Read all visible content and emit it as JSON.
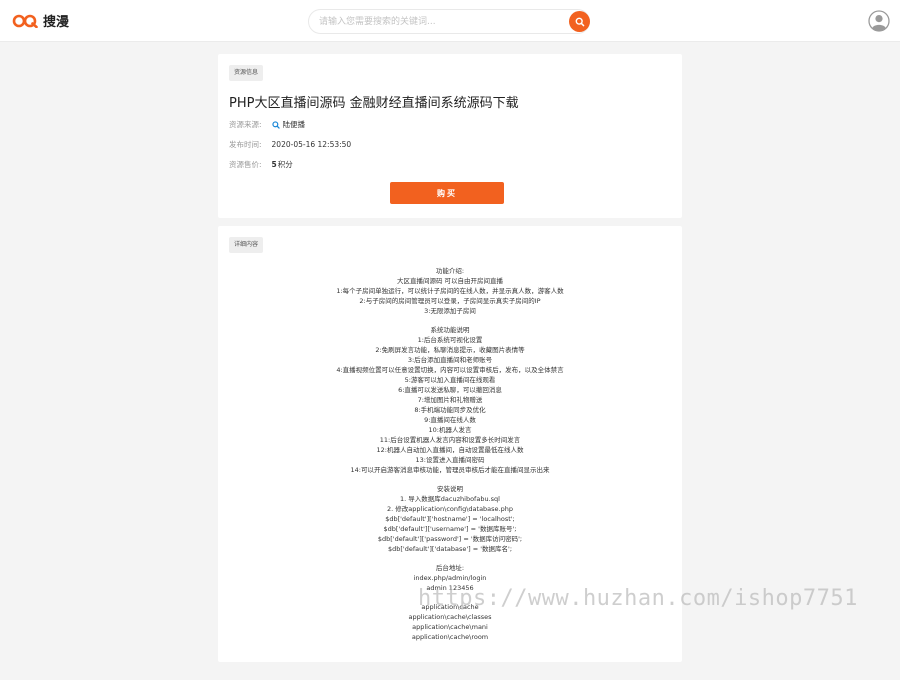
{
  "header": {
    "logo_text": "搜漫",
    "logo_color": "#f2611f",
    "search_placeholder": "请输入您需要搜索的关键词...",
    "search_icon": "search-icon",
    "avatar_icon": "user-avatar-icon"
  },
  "resource": {
    "tag": "资源信息",
    "title": "PHP大区直播间源码 金融财经直播间系统源码下载",
    "source_label": "资源来源:",
    "source_value": "陆便播",
    "date_label": "发布时间:",
    "date_value": "2020-05-16 12:53:50",
    "price_label": "资源售价:",
    "price_value": "5",
    "price_unit": "积分",
    "buy_label": "购买",
    "accent": "#f2611f",
    "link_color": "#1a87d6"
  },
  "detail": {
    "tag": "详细内容",
    "lines": [
      "功能介绍:",
      "大区直播间源码 可以自由开房间直播",
      "1:每个子房间单独运行，可以统计子房间的在线人数，并显示真人数，游客人数",
      "2:与子房间的房间管理员可以登录，子房间显示真实子房间的IP",
      "3:无限添加子房间",
      "",
      "系统功能说明",
      "1:后台系统可视化设置",
      "2:免刷屏发言功能，私聊消息提示，收藏图片表情等",
      "3:后台添加直播间和老师账号",
      "4:直播视频位置可以任意设置切换，内容可以设置审核后，发布，以及全体禁言",
      "5:游客可以加入直播间在线观看",
      "6:直播可以发送私聊，可以撤回消息",
      "7:增加图片和礼物赠送",
      "8:手机端功能同步及优化",
      "9:直播间在线人数",
      "10:机器人发言",
      "11:后台设置机器人发言内容和设置多长时间发言",
      "12:机器人自动加入直播间，自动设置最低在线人数",
      "13:设置进入直播间密码",
      "14:可以开启游客消息审核功能，管理员审核后才能在直播间显示出来",
      "",
      "安装说明",
      "1. 导入数据库dacuzhibofabu.sql",
      "2. 修改application\\config\\database.php",
      "$db['default']['hostname'] = 'localhost';",
      "$db['default']['username'] = '数据库账号';",
      "$db['default']['password'] = '数据库访问密码';",
      "$db['default']['database'] = '数据库名';",
      "",
      "后台地址:",
      "index.php/admin/login",
      "admin 123456",
      "",
      "application\\cache",
      "application\\cache\\classes",
      "application\\cache\\mani",
      "application\\cache\\room"
    ]
  },
  "watermark": "https://www.huzhan.com/ishop7751"
}
